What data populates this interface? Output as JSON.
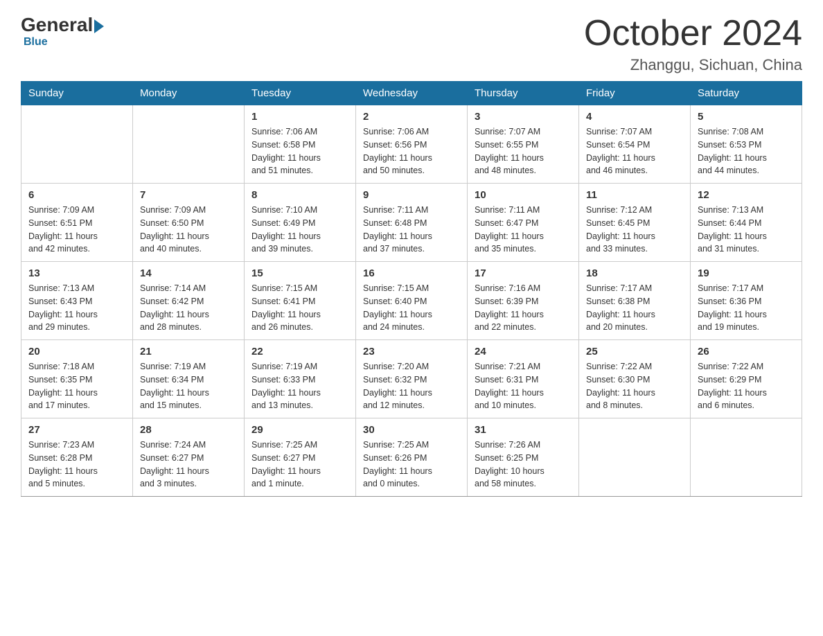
{
  "header": {
    "logo_general": "General",
    "logo_blue": "Blue",
    "month_title": "October 2024",
    "location": "Zhanggu, Sichuan, China"
  },
  "days_of_week": [
    "Sunday",
    "Monday",
    "Tuesday",
    "Wednesday",
    "Thursday",
    "Friday",
    "Saturday"
  ],
  "weeks": [
    [
      {
        "day": "",
        "info": ""
      },
      {
        "day": "",
        "info": ""
      },
      {
        "day": "1",
        "info": "Sunrise: 7:06 AM\nSunset: 6:58 PM\nDaylight: 11 hours\nand 51 minutes."
      },
      {
        "day": "2",
        "info": "Sunrise: 7:06 AM\nSunset: 6:56 PM\nDaylight: 11 hours\nand 50 minutes."
      },
      {
        "day": "3",
        "info": "Sunrise: 7:07 AM\nSunset: 6:55 PM\nDaylight: 11 hours\nand 48 minutes."
      },
      {
        "day": "4",
        "info": "Sunrise: 7:07 AM\nSunset: 6:54 PM\nDaylight: 11 hours\nand 46 minutes."
      },
      {
        "day": "5",
        "info": "Sunrise: 7:08 AM\nSunset: 6:53 PM\nDaylight: 11 hours\nand 44 minutes."
      }
    ],
    [
      {
        "day": "6",
        "info": "Sunrise: 7:09 AM\nSunset: 6:51 PM\nDaylight: 11 hours\nand 42 minutes."
      },
      {
        "day": "7",
        "info": "Sunrise: 7:09 AM\nSunset: 6:50 PM\nDaylight: 11 hours\nand 40 minutes."
      },
      {
        "day": "8",
        "info": "Sunrise: 7:10 AM\nSunset: 6:49 PM\nDaylight: 11 hours\nand 39 minutes."
      },
      {
        "day": "9",
        "info": "Sunrise: 7:11 AM\nSunset: 6:48 PM\nDaylight: 11 hours\nand 37 minutes."
      },
      {
        "day": "10",
        "info": "Sunrise: 7:11 AM\nSunset: 6:47 PM\nDaylight: 11 hours\nand 35 minutes."
      },
      {
        "day": "11",
        "info": "Sunrise: 7:12 AM\nSunset: 6:45 PM\nDaylight: 11 hours\nand 33 minutes."
      },
      {
        "day": "12",
        "info": "Sunrise: 7:13 AM\nSunset: 6:44 PM\nDaylight: 11 hours\nand 31 minutes."
      }
    ],
    [
      {
        "day": "13",
        "info": "Sunrise: 7:13 AM\nSunset: 6:43 PM\nDaylight: 11 hours\nand 29 minutes."
      },
      {
        "day": "14",
        "info": "Sunrise: 7:14 AM\nSunset: 6:42 PM\nDaylight: 11 hours\nand 28 minutes."
      },
      {
        "day": "15",
        "info": "Sunrise: 7:15 AM\nSunset: 6:41 PM\nDaylight: 11 hours\nand 26 minutes."
      },
      {
        "day": "16",
        "info": "Sunrise: 7:15 AM\nSunset: 6:40 PM\nDaylight: 11 hours\nand 24 minutes."
      },
      {
        "day": "17",
        "info": "Sunrise: 7:16 AM\nSunset: 6:39 PM\nDaylight: 11 hours\nand 22 minutes."
      },
      {
        "day": "18",
        "info": "Sunrise: 7:17 AM\nSunset: 6:38 PM\nDaylight: 11 hours\nand 20 minutes."
      },
      {
        "day": "19",
        "info": "Sunrise: 7:17 AM\nSunset: 6:36 PM\nDaylight: 11 hours\nand 19 minutes."
      }
    ],
    [
      {
        "day": "20",
        "info": "Sunrise: 7:18 AM\nSunset: 6:35 PM\nDaylight: 11 hours\nand 17 minutes."
      },
      {
        "day": "21",
        "info": "Sunrise: 7:19 AM\nSunset: 6:34 PM\nDaylight: 11 hours\nand 15 minutes."
      },
      {
        "day": "22",
        "info": "Sunrise: 7:19 AM\nSunset: 6:33 PM\nDaylight: 11 hours\nand 13 minutes."
      },
      {
        "day": "23",
        "info": "Sunrise: 7:20 AM\nSunset: 6:32 PM\nDaylight: 11 hours\nand 12 minutes."
      },
      {
        "day": "24",
        "info": "Sunrise: 7:21 AM\nSunset: 6:31 PM\nDaylight: 11 hours\nand 10 minutes."
      },
      {
        "day": "25",
        "info": "Sunrise: 7:22 AM\nSunset: 6:30 PM\nDaylight: 11 hours\nand 8 minutes."
      },
      {
        "day": "26",
        "info": "Sunrise: 7:22 AM\nSunset: 6:29 PM\nDaylight: 11 hours\nand 6 minutes."
      }
    ],
    [
      {
        "day": "27",
        "info": "Sunrise: 7:23 AM\nSunset: 6:28 PM\nDaylight: 11 hours\nand 5 minutes."
      },
      {
        "day": "28",
        "info": "Sunrise: 7:24 AM\nSunset: 6:27 PM\nDaylight: 11 hours\nand 3 minutes."
      },
      {
        "day": "29",
        "info": "Sunrise: 7:25 AM\nSunset: 6:27 PM\nDaylight: 11 hours\nand 1 minute."
      },
      {
        "day": "30",
        "info": "Sunrise: 7:25 AM\nSunset: 6:26 PM\nDaylight: 11 hours\nand 0 minutes."
      },
      {
        "day": "31",
        "info": "Sunrise: 7:26 AM\nSunset: 6:25 PM\nDaylight: 10 hours\nand 58 minutes."
      },
      {
        "day": "",
        "info": ""
      },
      {
        "day": "",
        "info": ""
      }
    ]
  ]
}
